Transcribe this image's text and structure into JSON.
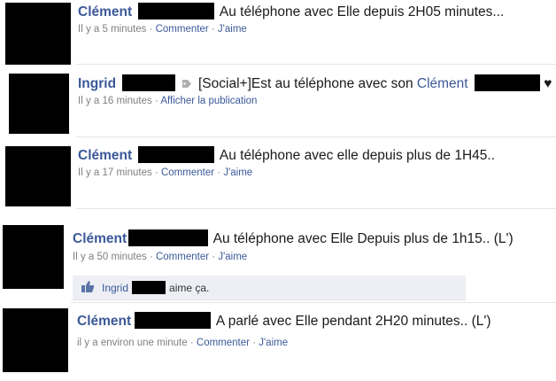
{
  "separator": "·",
  "posts": [
    {
      "author": "Clément",
      "status": "Au téléphone avec Elle depuis 2H05 minutes...",
      "time": "Il y a 5 minutes",
      "action1": "Commenter",
      "action2": "J'aime"
    },
    {
      "author": "Ingrid",
      "app_tag": "[Social+]",
      "status_prefix": "Est au téléphone avec son",
      "mention": "Clément",
      "heart": "♥",
      "time": "Il y a 16 minutes",
      "action1": "Afficher la publication"
    },
    {
      "author": "Clément",
      "status": "Au téléphone avec elle depuis plus de 1H45..",
      "time": "Il y a 17 minutes",
      "action1": "Commenter",
      "action2": "J'aime"
    },
    {
      "author": "Clément",
      "status": "Au téléphone avec Elle Depuis plus de 1h15.. (L')",
      "time": "Il y a 50 minutes",
      "action1": "Commenter",
      "action2": "J'aime",
      "like": {
        "name": "Ingrid",
        "text": "aime ça."
      }
    },
    {
      "author": "Clément",
      "status": "A parlé avec Elle pendant 2H20 minutes.. (L')",
      "time": "il y a environ une minute",
      "action1": "Commenter",
      "action2": "J'aime"
    }
  ],
  "colors": {
    "link": "#3b5998",
    "meta": "#808080",
    "like_bg": "#edeff4",
    "redaction": "#000000"
  },
  "icons": [
    "tag-icon",
    "thumbs-up-icon"
  ]
}
